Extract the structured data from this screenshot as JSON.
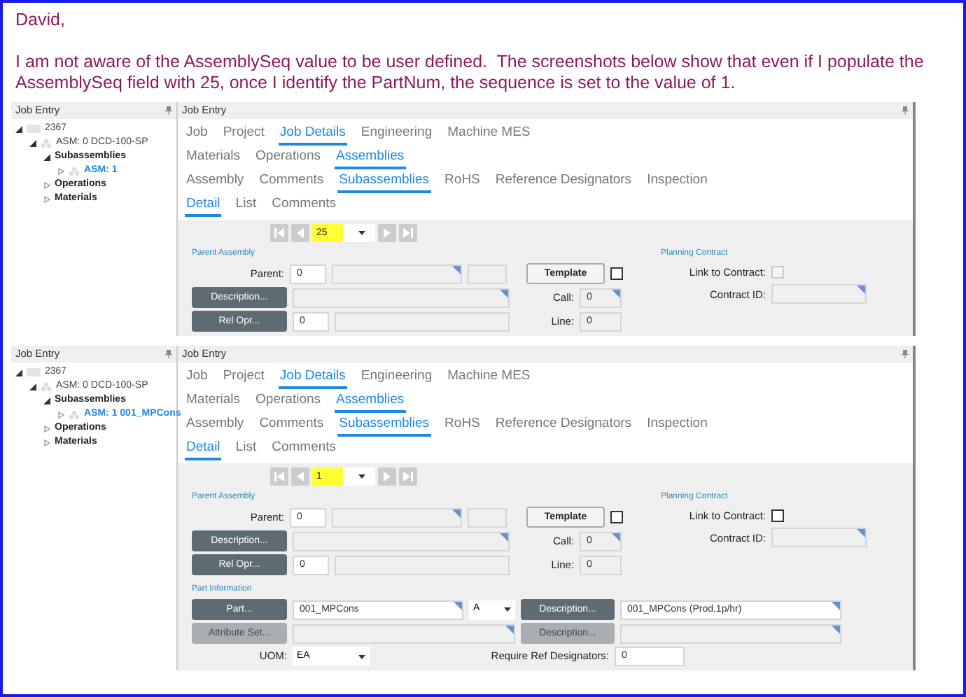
{
  "message": {
    "greeting": "David,",
    "body": "I am not aware of the AssemblySeq value to be user defined.  The screenshots below show that even if I populate the AssemblySeq field with 25, once I identify the PartNum, the sequence is set to the value of 1."
  },
  "screenshots": [
    {
      "tree_title": "Job Entry",
      "form_title": "Job Entry",
      "tree": [
        {
          "kind": "job",
          "label": "2367",
          "expanded": true,
          "selected": false,
          "children": [
            {
              "kind": "assembly",
              "label": "ASM: 0 DCD-100-SP",
              "expanded": true,
              "selected": false,
              "children": [
                {
                  "kind": "group",
                  "label": "Subassemblies",
                  "expanded": true,
                  "selected": false,
                  "children": [
                    {
                      "kind": "assembly",
                      "label": "ASM: 1",
                      "expanded": false,
                      "selected": true
                    }
                  ]
                },
                {
                  "kind": "group",
                  "label": "Operations",
                  "expanded": false,
                  "selected": false
                },
                {
                  "kind": "group",
                  "label": "Materials",
                  "expanded": false,
                  "selected": false
                }
              ]
            }
          ]
        }
      ],
      "tab_rows": [
        {
          "tabs": [
            {
              "label": "Job",
              "selected": false
            },
            {
              "label": "Project",
              "selected": false
            },
            {
              "label": "Job Details",
              "selected": true
            },
            {
              "label": "Engineering",
              "selected": false
            },
            {
              "label": "Machine MES",
              "selected": false
            }
          ]
        },
        {
          "tabs": [
            {
              "label": "Materials",
              "selected": false
            },
            {
              "label": "Operations",
              "selected": false
            },
            {
              "label": "Assemblies",
              "selected": true
            }
          ]
        },
        {
          "tabs": [
            {
              "label": "Assembly",
              "selected": false
            },
            {
              "label": "Comments",
              "selected": false
            },
            {
              "label": "Subassemblies",
              "selected": true
            },
            {
              "label": "RoHS",
              "selected": false
            },
            {
              "label": "Reference Designators",
              "selected": false
            },
            {
              "label": "Inspection",
              "selected": false
            }
          ]
        },
        {
          "tabs": [
            {
              "label": "Detail",
              "selected": true
            },
            {
              "label": "List",
              "selected": false
            },
            {
              "label": "Comments",
              "selected": false
            }
          ]
        }
      ],
      "nav_value": "25",
      "parent": {
        "section": "Parent Assembly",
        "parent_label": "Parent:",
        "parent_value": "0",
        "description_button": "Description...",
        "rel_opr_button": "Rel Opr...",
        "rel_opr_value": "0",
        "template_button": "Template",
        "template_checked": false,
        "call_label": "Call:",
        "call_value": "0",
        "line_label": "Line:",
        "line_value": "0"
      },
      "planning": {
        "section": "Planning Contract",
        "link_label": "Link to Contract:",
        "link_checked": false,
        "link_disabled": true,
        "contract_label": "Contract ID:"
      }
    },
    {
      "tree_title": "Job Entry",
      "form_title": "Job Entry",
      "tree": [
        {
          "kind": "job",
          "label": "2367",
          "expanded": true,
          "selected": false,
          "children": [
            {
              "kind": "assembly",
              "label": "ASM: 0 DCD-100-SP",
              "expanded": true,
              "selected": false,
              "children": [
                {
                  "kind": "group",
                  "label": "Subassemblies",
                  "expanded": true,
                  "selected": false,
                  "children": [
                    {
                      "kind": "assembly",
                      "label": "ASM: 1 001_MPCons",
                      "expanded": false,
                      "selected": true
                    }
                  ]
                },
                {
                  "kind": "group",
                  "label": "Operations",
                  "expanded": false,
                  "selected": false
                },
                {
                  "kind": "group",
                  "label": "Materials",
                  "expanded": false,
                  "selected": false
                }
              ]
            }
          ]
        }
      ],
      "tab_rows": [
        {
          "tabs": [
            {
              "label": "Job",
              "selected": false
            },
            {
              "label": "Project",
              "selected": false
            },
            {
              "label": "Job Details",
              "selected": true
            },
            {
              "label": "Engineering",
              "selected": false
            },
            {
              "label": "Machine MES",
              "selected": false
            }
          ]
        },
        {
          "tabs": [
            {
              "label": "Materials",
              "selected": false
            },
            {
              "label": "Operations",
              "selected": false
            },
            {
              "label": "Assemblies",
              "selected": true
            }
          ]
        },
        {
          "tabs": [
            {
              "label": "Assembly",
              "selected": false
            },
            {
              "label": "Comments",
              "selected": false
            },
            {
              "label": "Subassemblies",
              "selected": true
            },
            {
              "label": "RoHS",
              "selected": false
            },
            {
              "label": "Reference Designators",
              "selected": false
            },
            {
              "label": "Inspection",
              "selected": false
            }
          ]
        },
        {
          "tabs": [
            {
              "label": "Detail",
              "selected": true
            },
            {
              "label": "List",
              "selected": false
            },
            {
              "label": "Comments",
              "selected": false
            }
          ]
        }
      ],
      "nav_value": "1",
      "parent": {
        "section": "Parent Assembly",
        "parent_label": "Parent:",
        "parent_value": "0",
        "description_button": "Description...",
        "rel_opr_button": "Rel Opr...",
        "rel_opr_value": "0",
        "template_button": "Template",
        "template_checked": false,
        "call_label": "Call:",
        "call_value": "0",
        "line_label": "Line:",
        "line_value": "0"
      },
      "planning": {
        "section": "Planning Contract",
        "link_label": "Link to Contract:",
        "link_checked": false,
        "link_disabled": false,
        "contract_label": "Contract ID:"
      },
      "part": {
        "section": "Part Information",
        "part_button": "Part...",
        "part_value": "001_MPCons",
        "revision": "A",
        "description_button": "Description...",
        "description_value": "001_MPCons (Prod.1p/hr)",
        "attribute_button": "Attribute Set...",
        "attribute_disabled": true,
        "description2_button": "Description...",
        "description2_disabled": true,
        "uom_label": "UOM:",
        "uom_value": "EA",
        "require_label": "Require Ref Designators:",
        "require_value": "0"
      }
    }
  ]
}
